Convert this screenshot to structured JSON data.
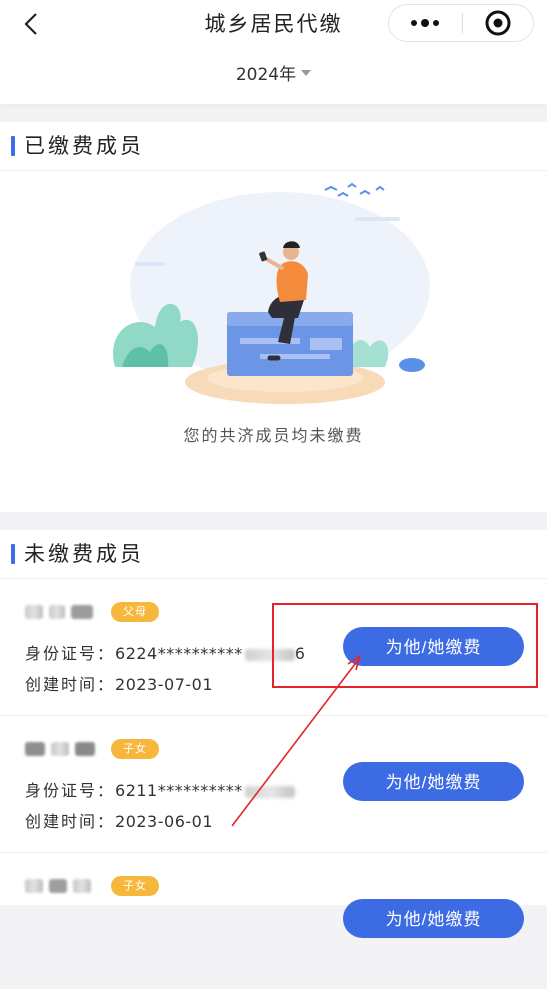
{
  "header": {
    "title": "城乡居民代缴",
    "year": "2024年"
  },
  "paid_section": {
    "title": "已缴费成员",
    "empty_text": "您的共济成员均未缴费"
  },
  "unpaid_section": {
    "title": "未缴费成员",
    "id_label": "身份证号：",
    "created_label": "创建时间：",
    "pay_button_label": "为他/她缴费",
    "members": [
      {
        "tag": "父母",
        "id_prefix": "6224**********",
        "id_tail": "6",
        "created": "2023-07-01"
      },
      {
        "tag": "子女",
        "id_prefix": "6211**********",
        "id_tail": "",
        "created": "2023-06-01"
      },
      {
        "tag": "子女",
        "id_prefix": "",
        "id_tail": "",
        "created": ""
      }
    ]
  },
  "colors": {
    "accent": "#3c6be3",
    "tag": "#f6b73c",
    "annotation": "#e1252b"
  }
}
